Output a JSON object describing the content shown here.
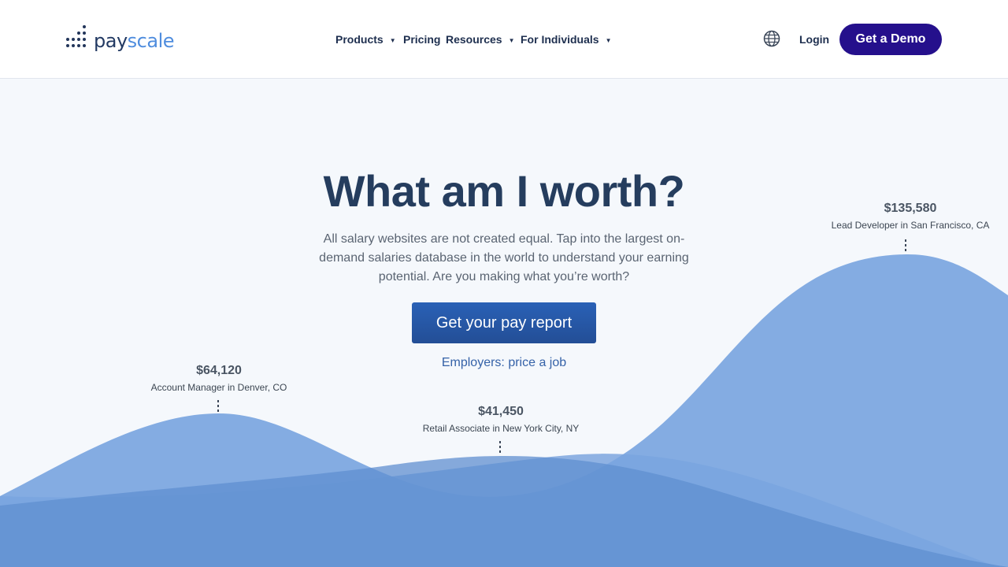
{
  "brand": {
    "name_part1": "pay",
    "name_part2": "scale"
  },
  "nav": {
    "items": [
      {
        "label": "Products",
        "has_dropdown": true
      },
      {
        "label": "Pricing",
        "has_dropdown": false
      },
      {
        "label": "Resources",
        "has_dropdown": true
      },
      {
        "label": "For Individuals",
        "has_dropdown": true
      }
    ],
    "globe_icon": "globe-icon",
    "login_label": "Login",
    "demo_label": "Get a Demo"
  },
  "hero": {
    "title": "What am I worth?",
    "subtitle": "All salary websites are not created equal. Tap into the largest on-demand salaries database in the world to understand your earning potential. Are you making what you’re worth?",
    "cta_label": "Get your pay report",
    "employers_link": "Employers: price a job"
  },
  "salaries": [
    {
      "amount": "$64,120",
      "title": "Account Manager in Denver, CO"
    },
    {
      "amount": "$41,450",
      "title": "Retail Associate in New York City, NY"
    },
    {
      "amount": "$135,580",
      "title": "Lead Developer in San Francisco, CA"
    }
  ],
  "colors": {
    "header_bg": "#ffffff",
    "page_bg": "#f5f8fc",
    "title": "#253d5e",
    "demo_button": "#25108c",
    "cta_button": "#2a5ca8",
    "wave_light": "#8fb2e3",
    "wave_mid": "#7aa5df",
    "wave_dark": "#5f8fd0"
  }
}
